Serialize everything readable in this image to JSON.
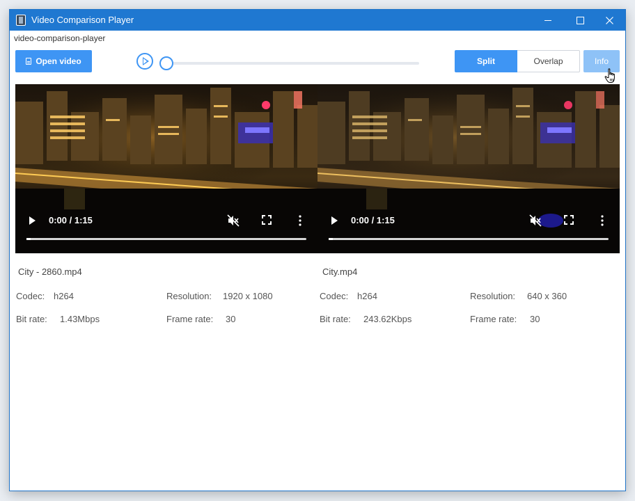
{
  "window": {
    "title": "Video Comparison Player"
  },
  "header": {
    "label": "video-comparison-player"
  },
  "toolbar": {
    "open_label": "Open video",
    "split_label": "Split",
    "overlap_label": "Overlap",
    "info_label": "Info",
    "mode_selected": "Split",
    "seek_position": 0
  },
  "videos": [
    {
      "time": "0:00 / 1:15",
      "file": "City - 2860.mp4",
      "codec_label": "Codec:",
      "codec": "h264",
      "resolution_label": "Resolution:",
      "resolution": "1920 x 1080",
      "bitrate_label": "Bit rate:",
      "bitrate": "1.43Mbps",
      "framerate_label": "Frame rate:",
      "framerate": "30"
    },
    {
      "time": "0:00 / 1:15",
      "file": "City.mp4",
      "codec_label": "Codec:",
      "codec": "h264",
      "resolution_label": "Resolution:",
      "resolution": "640 x 360",
      "bitrate_label": "Bit rate:",
      "bitrate": "243.62Kbps",
      "framerate_label": "Frame rate:",
      "framerate": "30"
    }
  ],
  "colors": {
    "titlebar": "#1f78d1",
    "accent": "#3e95f4",
    "info_button": "#8ec2f7"
  },
  "icons": {
    "app": "app-icon",
    "file": "file-icon",
    "play": "play-icon",
    "mute": "mute-icon",
    "fullscreen": "fullscreen-icon",
    "more": "more-icon",
    "cursor": "hand-cursor-icon"
  }
}
